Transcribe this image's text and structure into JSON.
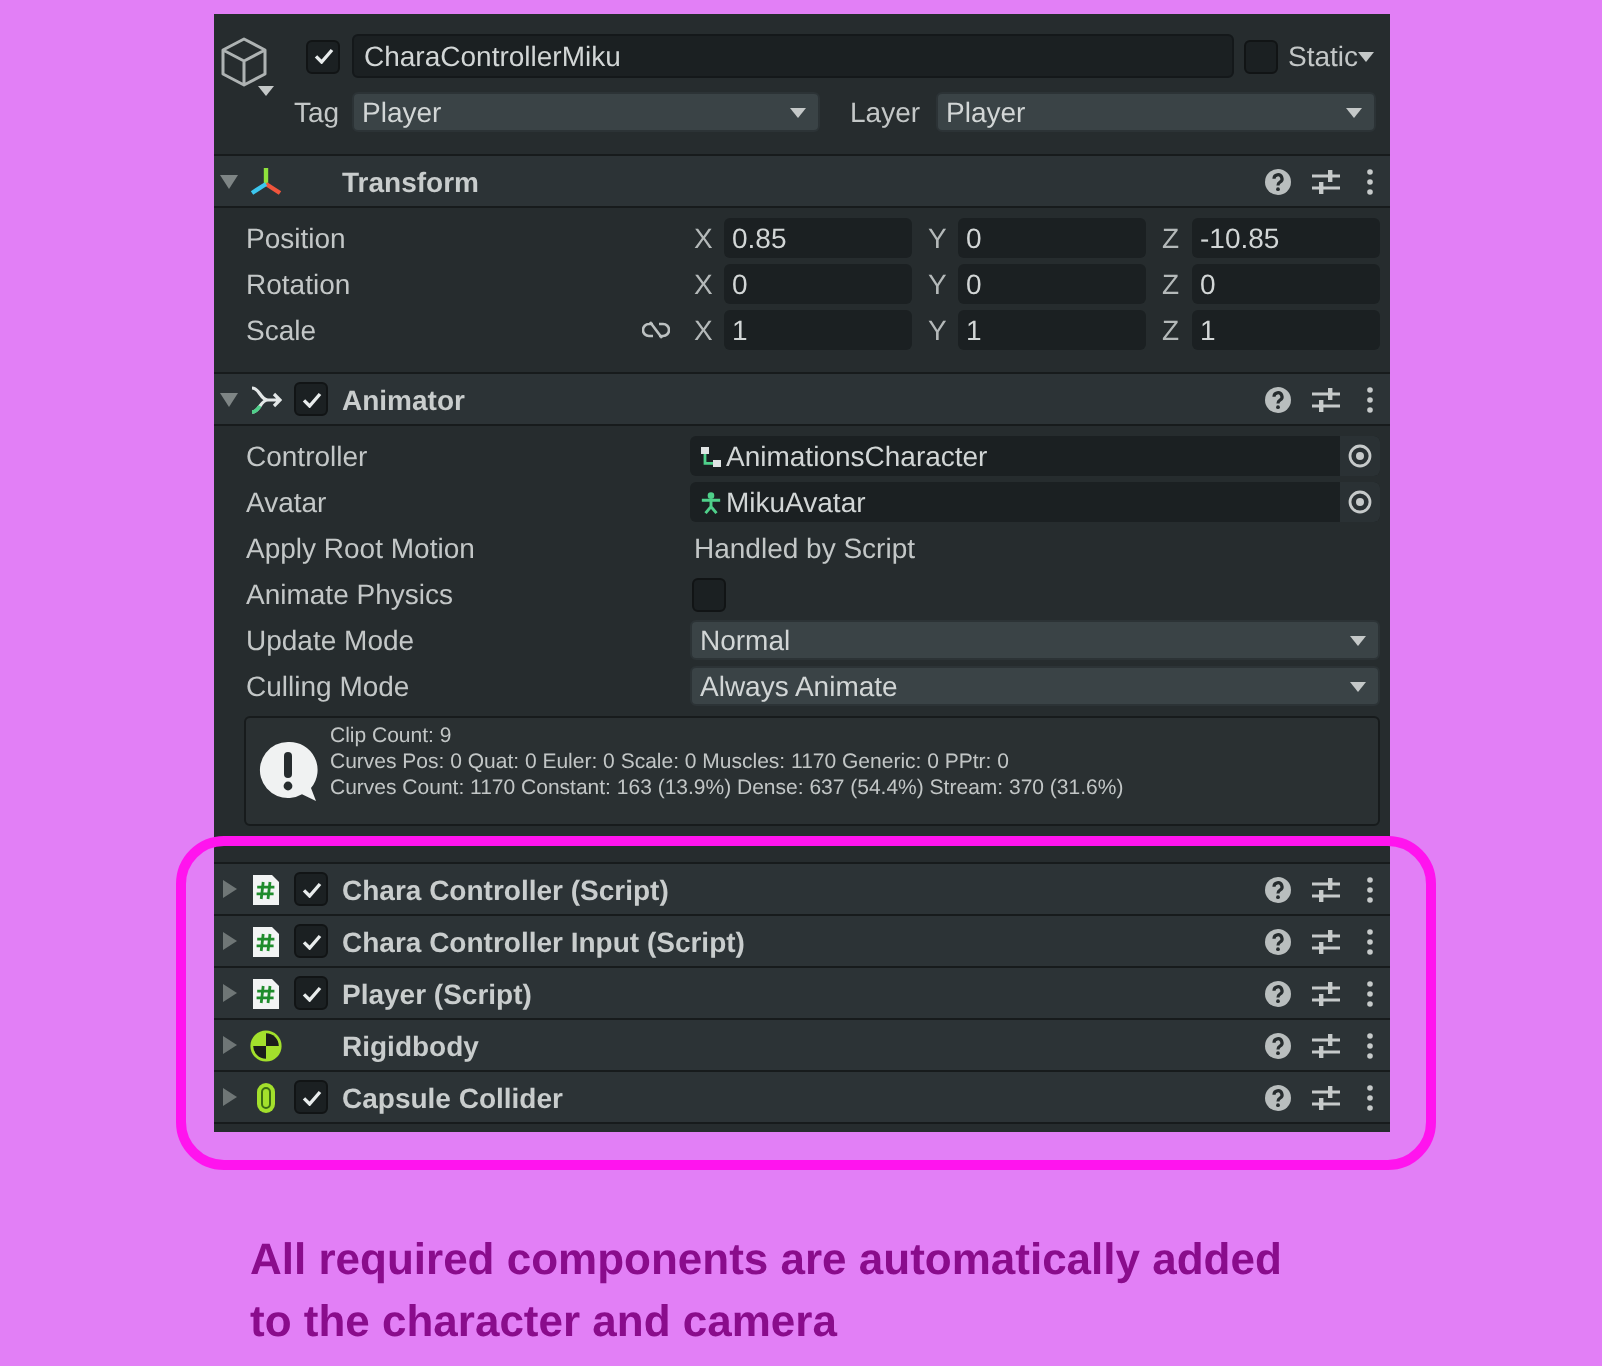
{
  "game_object": {
    "active": true,
    "name": "CharaControllerMiku",
    "static": false,
    "static_label": "Static",
    "tag_label": "Tag",
    "tag": "Player",
    "layer_label": "Layer",
    "layer": "Player"
  },
  "components": [
    {
      "kind": "transform",
      "title": "Transform",
      "expanded": true,
      "properties": [
        {
          "kind": "vector",
          "label": "Position",
          "axes": [
            {
              "axis": "X",
              "value": "0.85"
            },
            {
              "axis": "Y",
              "value": "0"
            },
            {
              "axis": "Z",
              "value": "-10.85"
            }
          ]
        },
        {
          "kind": "vector",
          "label": "Rotation",
          "axes": [
            {
              "axis": "X",
              "value": "0"
            },
            {
              "axis": "Y",
              "value": "0"
            },
            {
              "axis": "Z",
              "value": "0"
            }
          ]
        },
        {
          "kind": "scale",
          "label": "Scale",
          "axes": [
            {
              "axis": "X",
              "value": "1"
            },
            {
              "axis": "Y",
              "value": "1"
            },
            {
              "axis": "Z",
              "value": "1"
            }
          ]
        }
      ]
    },
    {
      "kind": "animator",
      "title": "Animator",
      "expanded": true,
      "enabled": true,
      "properties": [
        {
          "kind": "controller_ref",
          "label": "Controller",
          "value": "AnimationsCharacter"
        },
        {
          "kind": "avatar_ref",
          "label": "Avatar",
          "value": "MikuAvatar"
        },
        {
          "kind": "text",
          "label": "Apply Root Motion",
          "value": "Handled by Script"
        },
        {
          "kind": "toggle",
          "label": "Animate Physics",
          "checked": false
        },
        {
          "kind": "dropdown",
          "label": "Update Mode",
          "value": "Normal"
        },
        {
          "kind": "dropdown",
          "label": "Culling Mode",
          "value": "Always Animate"
        }
      ],
      "info": [
        "Clip Count: 9",
        "Curves Pos: 0 Quat: 0 Euler: 0 Scale: 0 Muscles: 1170 Generic: 0 PPtr: 0",
        "Curves Count: 1170 Constant: 163 (13.9%) Dense: 637 (54.4%) Stream: 370 (31.6%)"
      ]
    },
    {
      "kind": "script",
      "title": "Chara Controller (Script)",
      "expanded": false,
      "enabled": true
    },
    {
      "kind": "script",
      "title": "Chara Controller Input (Script)",
      "expanded": false,
      "enabled": true
    },
    {
      "kind": "script",
      "title": "Player (Script)",
      "expanded": false,
      "enabled": true
    },
    {
      "kind": "rigidbody",
      "title": "Rigidbody",
      "expanded": false
    },
    {
      "kind": "capsule_collider",
      "title": "Capsule Collider",
      "expanded": false,
      "enabled": true
    }
  ],
  "caption": "All required components are automatically added to the character and camera"
}
